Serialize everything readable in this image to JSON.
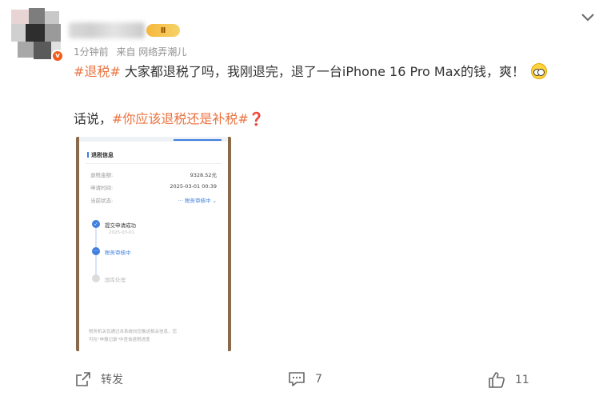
{
  "post": {
    "time": "1分钟前",
    "source": "来自 网络弄潮儿",
    "vip_badge": "Ⅱ",
    "verified_badge": "v",
    "line1": {
      "tag": "#退税#",
      "text": " 大家都退税了吗，我刚退完，退了一台iPhone 16 Pro Max的钱，爽！"
    },
    "line2": {
      "prefix": "话说，",
      "tag": "#你应该退税还是补税#",
      "suffix": "❓"
    }
  },
  "screenshot": {
    "card_title": "退税信息",
    "rows": [
      {
        "label": "退税金额:",
        "value": "9328.52元"
      },
      {
        "label": "申请时间:",
        "value": "2025-03-01 00:39"
      },
      {
        "label": "当前状态:",
        "value": "··· 税务审核中 ⌄"
      }
    ],
    "steps": [
      {
        "label": "提交申请成功",
        "date": "2025-03-01"
      },
      {
        "label": "税务审核中"
      },
      {
        "label": "国库处理"
      }
    ],
    "note_line1": "税务机关仅通过本系统向您推送相关信息，您",
    "note_line2": "可在\"申报记录\"中查询退税进度"
  },
  "actions": {
    "repost_label": "转发",
    "comment_count": "7",
    "like_count": "11"
  },
  "colors": {
    "accent": "#eb7340",
    "blue": "#3f7fe0"
  }
}
